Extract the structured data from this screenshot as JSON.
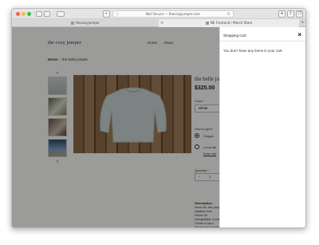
{
  "browser": {
    "url": "Not Secure — thecozyjumper.com",
    "lock_glyph": "ⓘ",
    "reload_glyph": "↻",
    "tabs": [
      {
        "title": "thecozyjumper"
      },
      {
        "title": "NE Frontend / Merch Store"
      }
    ],
    "traffic_colors": [
      "#fc5f57",
      "#fdbc2e",
      "#28c840"
    ]
  },
  "site": {
    "brand": "the cozy jumper",
    "nav": [
      "Home",
      "About"
    ]
  },
  "breadcrumb": {
    "home": "Home",
    "separator": "›",
    "current": "the belle jumper"
  },
  "gallery": {
    "up_arrow": "˄",
    "down_arrow": "˅",
    "thumb_count": 4
  },
  "product": {
    "title": "the belle ju",
    "price": "$325.00",
    "color_label": "Color *",
    "color_value": "White",
    "delivery_label": "How to get it",
    "delivery_options": [
      "Shippin",
      "Local del",
      "Enter del"
    ],
    "quantity_label": "Quantity *",
    "quantity_minus": "−",
    "quantity_value": "1",
    "quantity_plus": "+",
    "description_label": "Description",
    "description_text": "Hand knit, this jumper highland wool. Perfect it's unforgettable, w knit. Comes in any s assured responsibly warm, just like a war Shipping Info: Look"
  },
  "cart": {
    "title": "Shopping Cart",
    "close_glyph": "×",
    "empty_message": "You don't have any items in your cart."
  }
}
